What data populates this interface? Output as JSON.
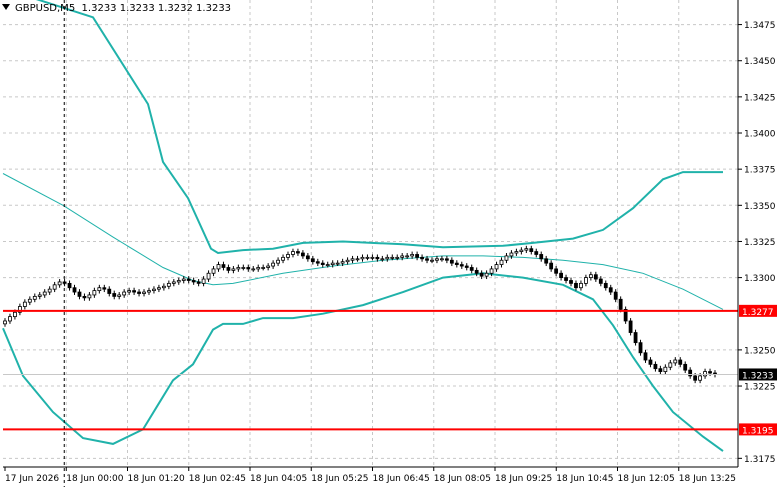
{
  "header": {
    "symbol_timeframe": "GBPUSD,M5",
    "quotes": "1.3233 1.3233 1.3232 1.3233"
  },
  "colors": {
    "background": "#ffffff",
    "grid": "#c8c8c8",
    "bollinger": "#20b2aa",
    "ma": "#20b2aa",
    "level_line": "#ff0000",
    "level_label_bg": "#ff0000",
    "price_label_bg": "#000000",
    "candle": "#000000"
  },
  "chart_data": {
    "type": "candlestick",
    "title": "",
    "y_axis": {
      "ylim": [
        1.3169,
        1.3492
      ],
      "ticks": [
        "1.3475",
        "1.3450",
        "1.3425",
        "1.3400",
        "1.3375",
        "1.3350",
        "1.3325",
        "1.3300",
        "1.3250",
        "1.3225",
        "1.3175"
      ]
    },
    "x_axis": {
      "ticks": [
        "17 Jun 2026",
        "18 Jun 00:00",
        "18 Jun 01:20",
        "18 Jun 02:45",
        "18 Jun 04:05",
        "18 Jun 05:25",
        "18 Jun 06:45",
        "18 Jun 08:05",
        "18 Jun 09:25",
        "18 Jun 10:45",
        "18 Jun 12:05",
        "18 Jun 13:25"
      ],
      "grid": true
    },
    "horizontal_levels": [
      {
        "value": 1.3277,
        "label": "1.3277"
      },
      {
        "value": 1.3195,
        "label": "1.3195"
      }
    ],
    "current_price": {
      "value": 1.3233,
      "label": "1.3233"
    },
    "crosshair_time": "18 Jun 00:00",
    "series": [
      {
        "kind": "bollinger_upper",
        "points": [
          [
            0,
            1.35
          ],
          [
            90,
            1.348
          ],
          [
            145,
            1.342
          ],
          [
            160,
            1.338
          ],
          [
            185,
            1.3355
          ],
          [
            208,
            1.332
          ],
          [
            215,
            1.3317
          ],
          [
            240,
            1.3319
          ],
          [
            270,
            1.332
          ],
          [
            300,
            1.3324
          ],
          [
            340,
            1.3325
          ],
          [
            400,
            1.3323
          ],
          [
            440,
            1.3321
          ],
          [
            500,
            1.3322
          ],
          [
            530,
            1.3324
          ],
          [
            570,
            1.3327
          ],
          [
            600,
            1.3333
          ],
          [
            630,
            1.3348
          ],
          [
            660,
            1.3368
          ],
          [
            680,
            1.3373
          ],
          [
            720,
            1.3373
          ]
        ]
      },
      {
        "kind": "bollinger_middle",
        "points": [
          [
            0,
            1.3372
          ],
          [
            60,
            1.335
          ],
          [
            110,
            1.3328
          ],
          [
            160,
            1.3307
          ],
          [
            190,
            1.3298
          ],
          [
            210,
            1.3295
          ],
          [
            230,
            1.3296
          ],
          [
            280,
            1.3303
          ],
          [
            330,
            1.3308
          ],
          [
            380,
            1.3312
          ],
          [
            440,
            1.3315
          ],
          [
            480,
            1.3315
          ],
          [
            520,
            1.3314
          ],
          [
            560,
            1.3312
          ],
          [
            600,
            1.3309
          ],
          [
            640,
            1.3303
          ],
          [
            680,
            1.3292
          ],
          [
            720,
            1.3278
          ]
        ]
      },
      {
        "kind": "bollinger_lower",
        "points": [
          [
            0,
            1.3265
          ],
          [
            20,
            1.3232
          ],
          [
            50,
            1.3207
          ],
          [
            80,
            1.3189
          ],
          [
            110,
            1.3185
          ],
          [
            140,
            1.3195
          ],
          [
            155,
            1.3212
          ],
          [
            170,
            1.3229
          ],
          [
            190,
            1.324
          ],
          [
            210,
            1.3264
          ],
          [
            220,
            1.3268
          ],
          [
            240,
            1.3268
          ],
          [
            260,
            1.3272
          ],
          [
            290,
            1.3272
          ],
          [
            320,
            1.3275
          ],
          [
            360,
            1.3281
          ],
          [
            400,
            1.329
          ],
          [
            440,
            1.33
          ],
          [
            480,
            1.3303
          ],
          [
            520,
            1.33
          ],
          [
            560,
            1.3295
          ],
          [
            590,
            1.3285
          ],
          [
            610,
            1.3267
          ],
          [
            630,
            1.3245
          ],
          [
            650,
            1.3225
          ],
          [
            670,
            1.3207
          ],
          [
            700,
            1.319
          ],
          [
            720,
            1.318
          ]
        ]
      }
    ],
    "candles_close": [
      1.327,
      1.3273,
      1.3276,
      1.328,
      1.3283,
      1.3285,
      1.3287,
      1.3288,
      1.329,
      1.3292,
      1.3295,
      1.3297,
      1.3296,
      1.3293,
      1.329,
      1.3287,
      1.3286,
      1.3288,
      1.3291,
      1.3293,
      1.3292,
      1.3289,
      1.3287,
      1.3288,
      1.329,
      1.3291,
      1.329,
      1.3289,
      1.329,
      1.3291,
      1.3292,
      1.3293,
      1.3294,
      1.3296,
      1.3297,
      1.3298,
      1.3299,
      1.3298,
      1.3297,
      1.3296,
      1.3299,
      1.3303,
      1.3306,
      1.3309,
      1.3307,
      1.3305,
      1.3306,
      1.3307,
      1.3307,
      1.3306,
      1.3306,
      1.3307,
      1.3307,
      1.3308,
      1.331,
      1.3312,
      1.3314,
      1.3316,
      1.3318,
      1.3317,
      1.3315,
      1.3313,
      1.3311,
      1.331,
      1.3309,
      1.3309,
      1.331,
      1.331,
      1.3311,
      1.3312,
      1.3313,
      1.3313,
      1.3314,
      1.3314,
      1.3314,
      1.3313,
      1.3313,
      1.3314,
      1.3314,
      1.3314,
      1.3315,
      1.3315,
      1.3316,
      1.3314,
      1.3313,
      1.3312,
      1.3312,
      1.3313,
      1.3313,
      1.3312,
      1.331,
      1.3309,
      1.3308,
      1.3307,
      1.3305,
      1.3303,
      1.3301,
      1.3303,
      1.3306,
      1.3309,
      1.3312,
      1.3315,
      1.3317,
      1.3318,
      1.3319,
      1.332,
      1.3318,
      1.3316,
      1.3313,
      1.331,
      1.3306,
      1.3303,
      1.33,
      1.3298,
      1.3296,
      1.3293,
      1.3296,
      1.33,
      1.3302,
      1.3299,
      1.3296,
      1.3293,
      1.329,
      1.3285,
      1.3278,
      1.327,
      1.3262,
      1.3255,
      1.3248,
      1.3243,
      1.324,
      1.3237,
      1.3235,
      1.3238,
      1.3241,
      1.3243,
      1.324,
      1.3236,
      1.3232,
      1.3229,
      1.3232,
      1.3235,
      1.3234,
      1.3233
    ]
  }
}
